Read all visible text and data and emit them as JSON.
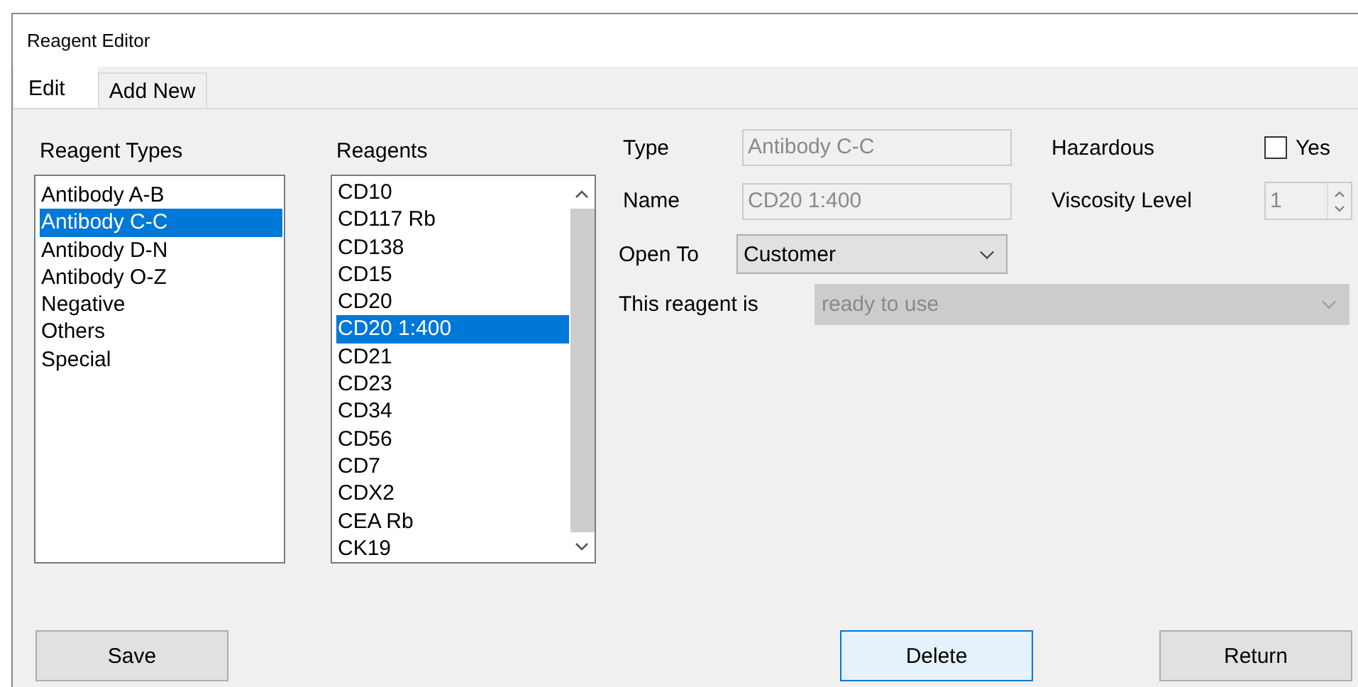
{
  "window": {
    "title": "Reagent Editor"
  },
  "tabs": [
    {
      "label": "Edit",
      "selected": true
    },
    {
      "label": "Add New",
      "selected": false
    }
  ],
  "reagent_types": {
    "label": "Reagent Types",
    "items": [
      {
        "label": "Antibody A-B",
        "selected": false
      },
      {
        "label": "Antibody C-C",
        "selected": true
      },
      {
        "label": "Antibody D-N",
        "selected": false
      },
      {
        "label": "Antibody O-Z",
        "selected": false
      },
      {
        "label": "Negative",
        "selected": false
      },
      {
        "label": "Others",
        "selected": false
      },
      {
        "label": "Special",
        "selected": false
      }
    ]
  },
  "reagents": {
    "label": "Reagents",
    "items": [
      {
        "label": "CD10",
        "selected": false
      },
      {
        "label": "CD117 Rb",
        "selected": false
      },
      {
        "label": "CD138",
        "selected": false
      },
      {
        "label": "CD15",
        "selected": false
      },
      {
        "label": "CD20",
        "selected": false
      },
      {
        "label": "CD20 1:400",
        "selected": true
      },
      {
        "label": "CD21",
        "selected": false
      },
      {
        "label": "CD23",
        "selected": false
      },
      {
        "label": "CD34",
        "selected": false
      },
      {
        "label": "CD56",
        "selected": false
      },
      {
        "label": "CD7",
        "selected": false
      },
      {
        "label": "CDX2",
        "selected": false
      },
      {
        "label": "CEA Rb",
        "selected": false
      },
      {
        "label": "CK19",
        "selected": false
      }
    ]
  },
  "form": {
    "type": {
      "label": "Type",
      "value": "Antibody C-C",
      "disabled": true
    },
    "name": {
      "label": "Name",
      "value": "CD20 1:400",
      "disabled": true
    },
    "hazardous": {
      "label": "Hazardous",
      "option": "Yes",
      "checked": false
    },
    "viscosity": {
      "label": "Viscosity Level",
      "value": "1",
      "disabled": true
    },
    "open_to": {
      "label": "Open To",
      "value": "Customer",
      "disabled": false
    },
    "status": {
      "label": "This reagent is",
      "value": "ready to use",
      "disabled": true
    }
  },
  "buttons": [
    {
      "label": "Save",
      "focused": false
    },
    {
      "label": "Delete",
      "focused": true
    },
    {
      "label": "Return",
      "focused": false
    }
  ]
}
